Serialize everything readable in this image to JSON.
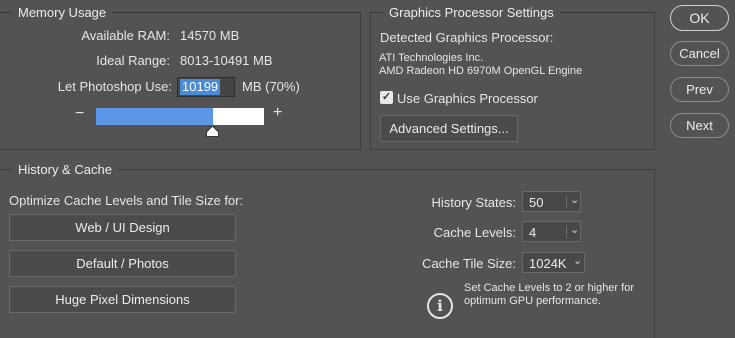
{
  "memory": {
    "legend": "Memory Usage",
    "available_label": "Available RAM:",
    "available_value": "14570 MB",
    "ideal_label": "Ideal Range:",
    "ideal_value": "8013-10491 MB",
    "let_label": "Let Photoshop Use:",
    "let_value": "10199",
    "let_suffix": "MB (70%)",
    "minus": "−",
    "plus": "+",
    "slider_fraction": 0.7
  },
  "gpu": {
    "legend": "Graphics Processor Settings",
    "detected_label": "Detected Graphics Processor:",
    "vendor": "ATI Technologies Inc.",
    "model": "AMD Radeon HD 6970M OpenGL Engine",
    "use_gpu_label": "Use Graphics Processor",
    "use_gpu_checked": true,
    "advanced_button": "Advanced Settings..."
  },
  "history": {
    "legend": "History & Cache",
    "optimize_label": "Optimize Cache Levels and Tile Size for:",
    "presets": [
      "Web / UI Design",
      "Default / Photos",
      "Huge Pixel Dimensions"
    ],
    "history_states_label": "History States:",
    "history_states_value": "50",
    "cache_levels_label": "Cache Levels:",
    "cache_levels_value": "4",
    "tile_size_label": "Cache Tile Size:",
    "tile_size_value": "1024K",
    "hint_line1": "Set Cache Levels to 2 or higher for",
    "hint_line2": "optimum GPU performance."
  },
  "dialog_buttons": {
    "ok": "OK",
    "cancel": "Cancel",
    "prev": "Prev",
    "next": "Next"
  }
}
